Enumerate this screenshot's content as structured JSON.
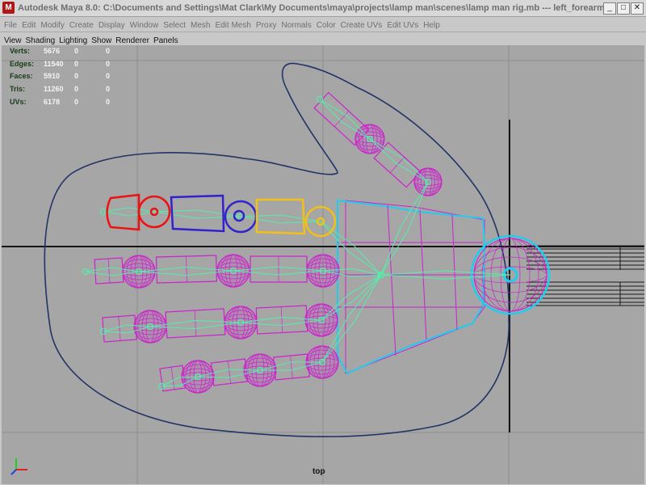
{
  "window": {
    "title": "Autodesk Maya 8.0: C:\\Documents and Settings\\Mat Clark\\My Documents\\maya\\projects\\lamp man\\scenes\\lamp man rig.mb  ---  left_forearm | left...",
    "minimize": "_",
    "maximize": "□",
    "close": "✕"
  },
  "menu": [
    "File",
    "Edit",
    "Modify",
    "Create",
    "Display",
    "Window",
    "Select",
    "Mesh",
    "Edit Mesh",
    "Proxy",
    "Normals",
    "Color",
    "Create UVs",
    "Edit UVs",
    "Help"
  ],
  "panel_menu": [
    "View",
    "Shading",
    "Lighting",
    "Show",
    "Renderer",
    "Panels"
  ],
  "hud": [
    {
      "label": "Verts:",
      "v1": "5676",
      "v2": "0",
      "v3": "0"
    },
    {
      "label": "Edges:",
      "v1": "11540",
      "v2": "0",
      "v3": "0"
    },
    {
      "label": "Faces:",
      "v1": "5910",
      "v2": "0",
      "v3": "0"
    },
    {
      "label": "Tris:",
      "v1": "11260",
      "v2": "0",
      "v3": "0"
    },
    {
      "label": "UVs:",
      "v1": "6178",
      "v2": "0",
      "v3": "0"
    }
  ],
  "camera_label": "top",
  "colors": {
    "mesh": "#cc22cc",
    "joint": "#55eeaa",
    "selected": "#22ccee",
    "ctrl_red": "#ee1111",
    "ctrl_blue": "#3322cc",
    "ctrl_yellow": "#f2c018",
    "outline": "#223366"
  }
}
